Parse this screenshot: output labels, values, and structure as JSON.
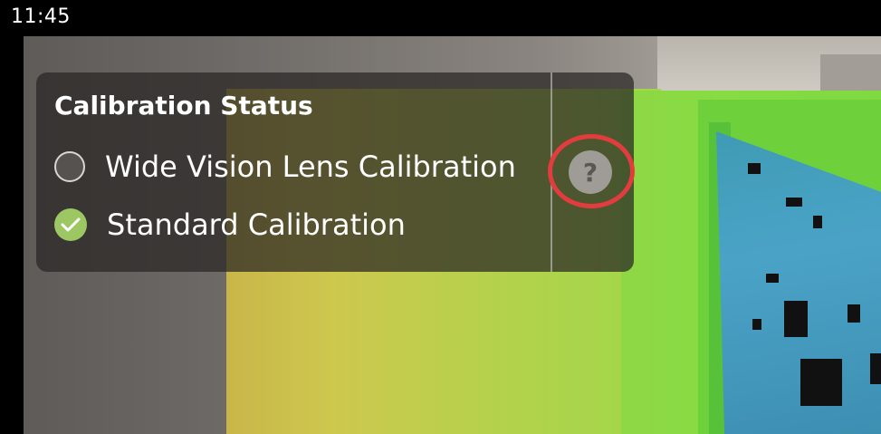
{
  "status_bar": {
    "time": "11:45"
  },
  "calibration_panel": {
    "title": "Calibration Status",
    "items": [
      {
        "label": "Wide Vision Lens Calibration",
        "state": "unchecked",
        "icon": "radio-empty-icon"
      },
      {
        "label": "Standard Calibration",
        "state": "checked",
        "icon": "check-circle-icon"
      }
    ],
    "help_label": "?",
    "colors": {
      "panel_background": "#282624",
      "check_green": "#9cc763",
      "highlight_ring": "#e23c3e"
    }
  }
}
